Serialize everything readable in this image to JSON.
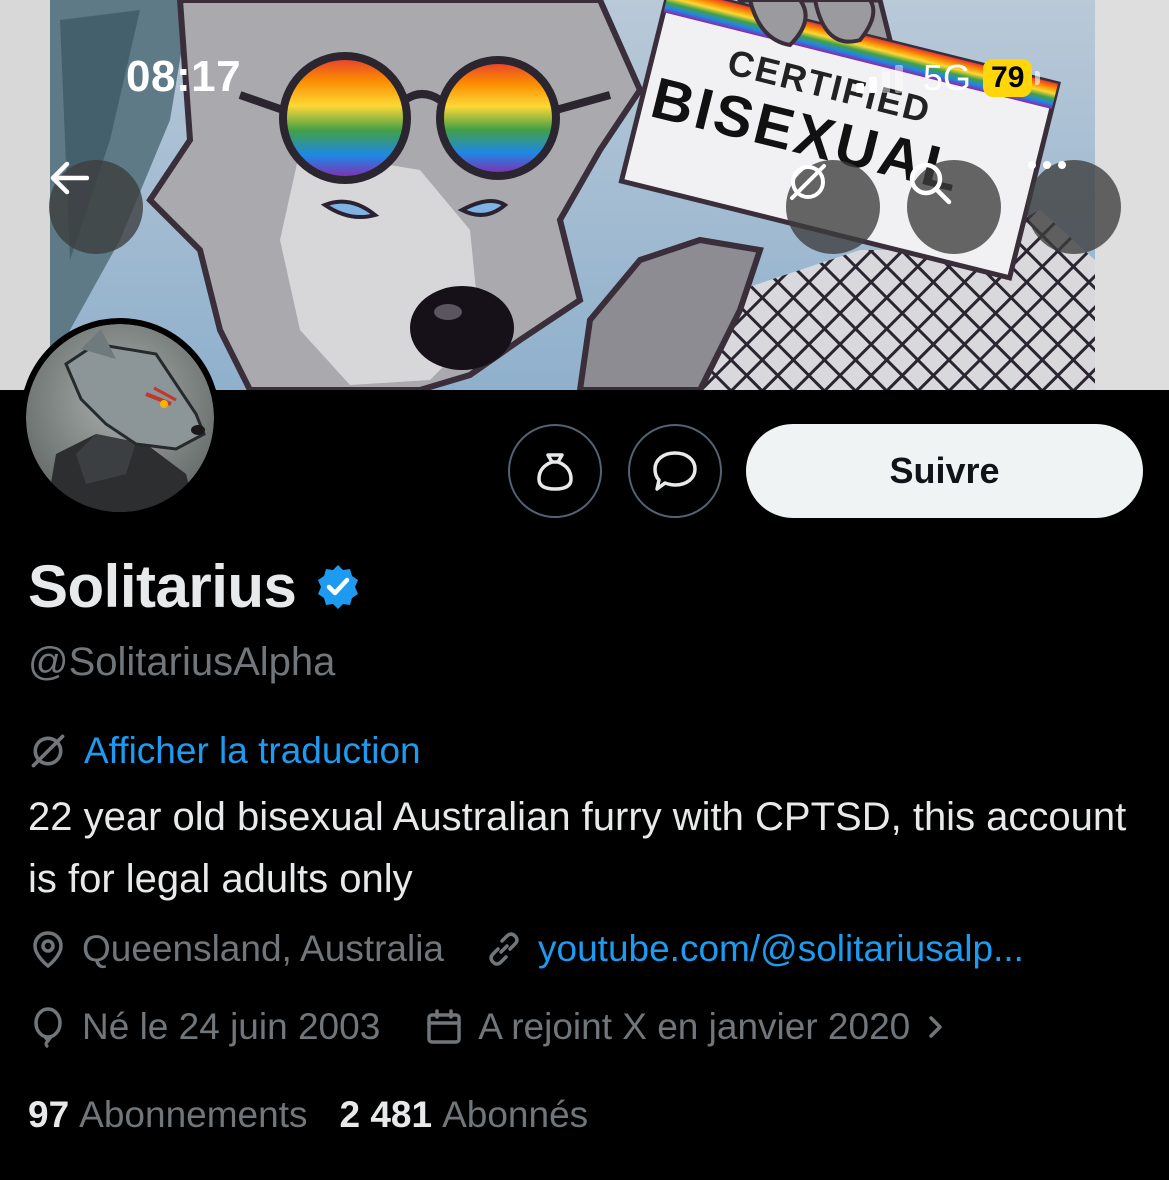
{
  "status_bar": {
    "time": "08:17",
    "network": "5G",
    "battery": "79"
  },
  "banner": {
    "sign_line1": "CERTIFIED",
    "sign_line2": "BISEXUAL"
  },
  "profile": {
    "display_name": "Solitarius",
    "handle": "@SolitariusAlpha",
    "translate_label": "Afficher la traduction",
    "bio": "22 year old bisexual Australian furry with CPTSD, this account is for legal adults only",
    "location": "Queensland, Australia",
    "website": "youtube.com/@solitariusalp...",
    "birthday": "Né le 24 juin 2003",
    "joined": "A rejoint X en janvier 2020",
    "following_count": "97",
    "following_label": "Abonnements",
    "followers_count": "2 481",
    "followers_label": "Abonnés"
  },
  "actions": {
    "follow_label": "Suivre"
  },
  "colors": {
    "accent": "#1d9bf0",
    "muted": "#71767b",
    "text": "#e7e9ea",
    "battery": "#ffd60a"
  },
  "icons": [
    "back-arrow-icon",
    "translate-icon",
    "search-icon",
    "more-icon",
    "tip-jar-icon",
    "message-icon",
    "verified-badge-icon",
    "location-icon",
    "link-icon",
    "balloon-icon",
    "calendar-icon",
    "chevron-right-icon"
  ]
}
